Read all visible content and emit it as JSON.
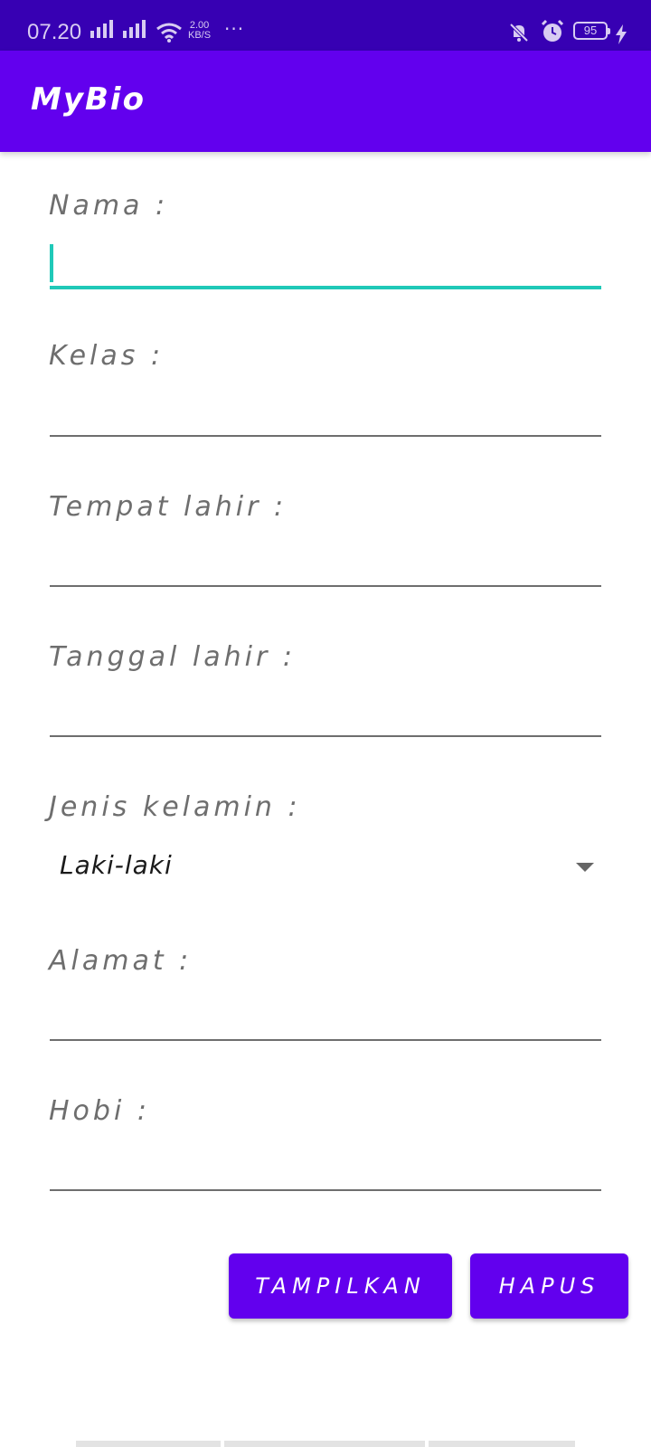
{
  "status_bar": {
    "time": "07.20",
    "network_speed_value": "2.00",
    "network_speed_unit": "KB/S",
    "more_indicator": "···",
    "battery_level": "95",
    "icons": [
      "signal-icon",
      "signal-icon",
      "wifi-icon",
      "bell-off-icon",
      "alarm-icon",
      "battery-icon",
      "charging-icon"
    ]
  },
  "app_bar": {
    "title": "MyBio"
  },
  "form": {
    "nama_label": "Nama :",
    "nama_value": "",
    "kelas_label": "Kelas :",
    "kelas_value": "",
    "tempat_lahir_label": "Tempat lahir :",
    "tempat_lahir_value": "",
    "tanggal_lahir_label": "Tanggal lahir :",
    "tanggal_lahir_value": "",
    "jenis_kelamin_label": "Jenis kelamin :",
    "jenis_kelamin_value": "Laki-laki",
    "alamat_label": "Alamat :",
    "alamat_value": "",
    "hobi_label": "Hobi :",
    "hobi_value": ""
  },
  "buttons": {
    "tampilkan_label": "TAMPILKAN",
    "hapus_label": "HAPUS"
  },
  "colors": {
    "status_bar": "#3700b3",
    "primary": "#6200ee",
    "accent_focus": "#20c9b8",
    "label_text": "#6e6e6e"
  }
}
